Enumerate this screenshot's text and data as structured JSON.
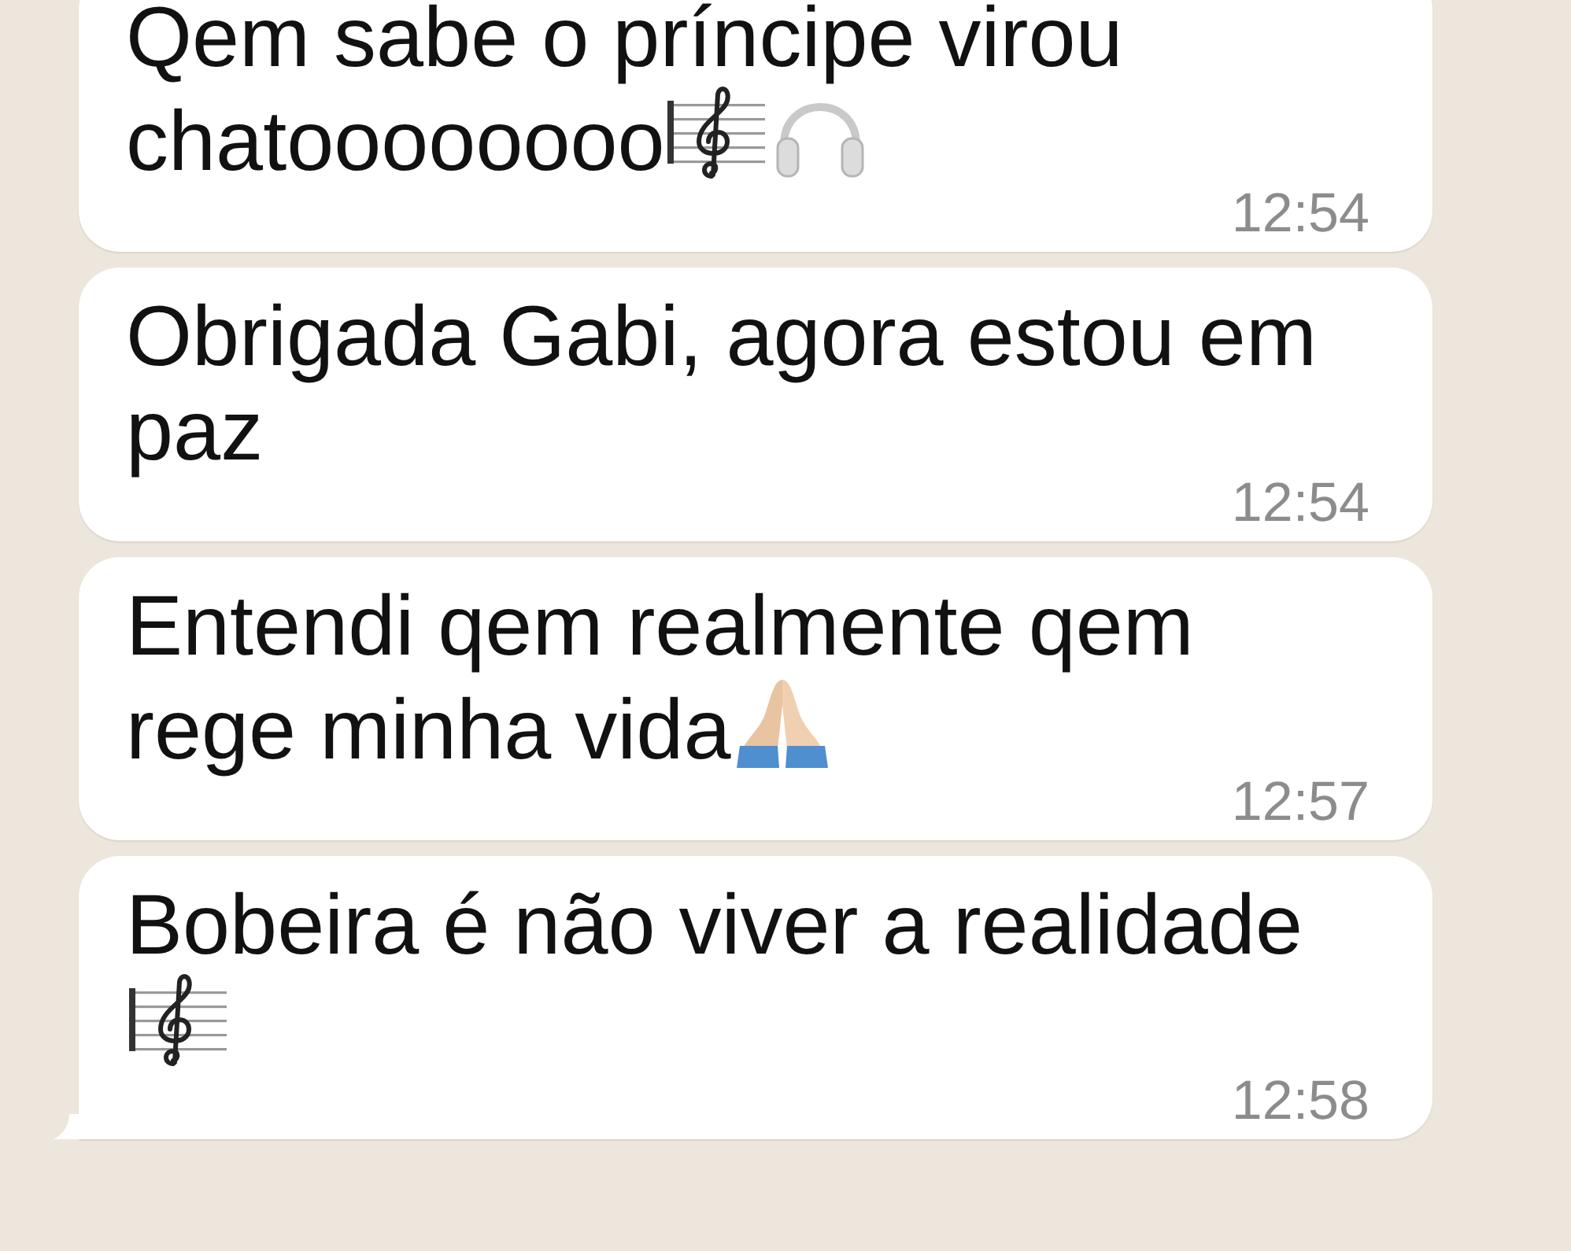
{
  "messages": [
    {
      "text": "Qem sabe o príncipe virou chatoooooooo",
      "emojis": [
        {
          "kind": "score"
        },
        {
          "kind": "headphones"
        }
      ],
      "time": "12:54",
      "tail": false
    },
    {
      "text": "Obrigada Gabi, agora estou em paz",
      "time": "12:54",
      "tail": false
    },
    {
      "text": "Entendi qem realmente qem rege minha vida",
      "emojis": [
        {
          "kind": "praying-hands"
        }
      ],
      "time": "12:57",
      "tail": false
    },
    {
      "text": "Bobeira é não viver a realidade",
      "emojis": [
        {
          "kind": "score"
        }
      ],
      "time": "12:58",
      "tail": true
    }
  ]
}
